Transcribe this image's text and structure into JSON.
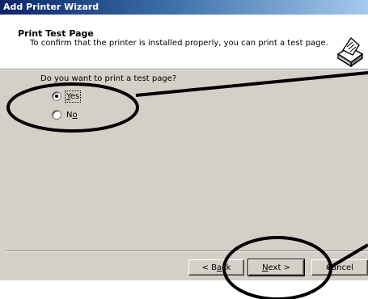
{
  "window": {
    "title": "Add Printer Wizard"
  },
  "header": {
    "title": "Print Test Page",
    "subtitle": "To confirm that the printer is installed properly, you can print a test page.",
    "icon": "printer-icon"
  },
  "body": {
    "question": "Do you want to print a test page?",
    "options": [
      {
        "label": "Yes",
        "mnemonic": "Y",
        "selected": true
      },
      {
        "label": "No",
        "mnemonic": "o",
        "selected": false
      }
    ]
  },
  "buttons": {
    "back": {
      "label": "< Back",
      "mnemonic": "a"
    },
    "next": {
      "label": "Next >",
      "mnemonic": "N"
    },
    "cancel": {
      "label": "Cancel"
    }
  },
  "annotations": {
    "color": "#000000",
    "shapes": [
      "ellipse",
      "ellipse",
      "line",
      "line"
    ]
  }
}
